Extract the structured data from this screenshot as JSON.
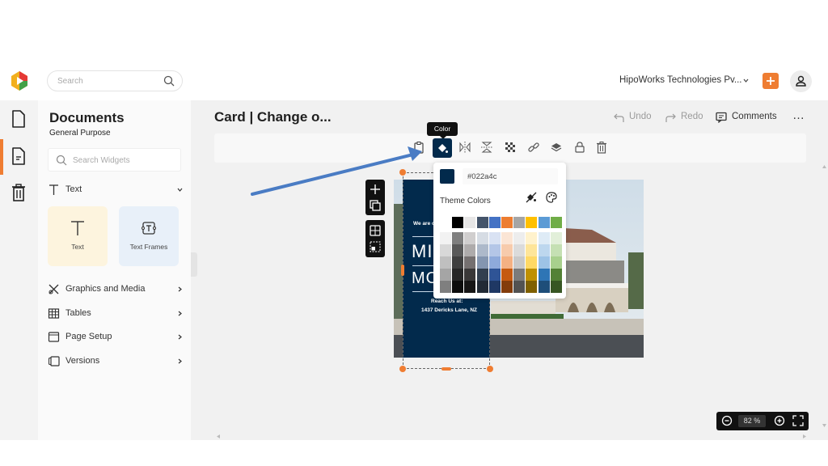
{
  "header": {
    "search_placeholder": "Search",
    "org_name": "HipoWorks Technologies Pv...",
    "add_button": "+",
    "brand_color": "#ef7d32"
  },
  "rail": {
    "items": [
      {
        "icon": "file-icon",
        "active": false
      },
      {
        "icon": "document-icon",
        "active": true
      },
      {
        "icon": "trash-icon",
        "active": false
      }
    ]
  },
  "panel": {
    "title": "Documents",
    "subtitle": "General Purpose",
    "search_placeholder": "Search Widgets",
    "text_section": "Text",
    "tiles": [
      {
        "label": "Text",
        "icon": "text-icon"
      },
      {
        "label": "Text Frames",
        "icon": "text-frame-icon"
      }
    ],
    "sections": [
      {
        "label": "Graphics and Media",
        "icon": "graphics-icon"
      },
      {
        "label": "Tables",
        "icon": "table-icon"
      },
      {
        "label": "Page Setup",
        "icon": "page-setup-icon"
      },
      {
        "label": "Versions",
        "icon": "versions-icon"
      }
    ]
  },
  "document": {
    "title": "Card | Change o...",
    "undo": "Undo",
    "redo": "Redo",
    "comments": "Comments",
    "more": "…"
  },
  "toolbar": {
    "tooltip": "Color",
    "items": [
      "paste-icon",
      "color-fill-icon",
      "flip-horizontal-icon",
      "flip-vertical-icon",
      "transparency-icon",
      "link-icon",
      "layers-icon",
      "lock-icon",
      "delete-icon"
    ]
  },
  "card": {
    "intro": "We are o",
    "line1": "MI",
    "line2": "MO",
    "reach": "Reach Us at:",
    "address": "1437 Dericks Lane, NZ"
  },
  "color_picker": {
    "current_hex": "#022a4c",
    "theme_label": "Theme Colors",
    "base_row": [
      "#ffffff",
      "#000000",
      "#e7e6e6",
      "#44546a",
      "#4472c4",
      "#ed7d31",
      "#a5a5a5",
      "#ffc000",
      "#5b9bd5",
      "#70ad47"
    ],
    "shade_rows": [
      [
        "#f2f2f2",
        "#7f7f7f",
        "#d0cece",
        "#d6dce4",
        "#d9e2f3",
        "#fbe5d5",
        "#ededed",
        "#fff2cc",
        "#deebf6",
        "#e2efd9"
      ],
      [
        "#d8d8d8",
        "#595959",
        "#aeabab",
        "#adb9ca",
        "#b4c6e7",
        "#f7cbac",
        "#dbdbdb",
        "#fee599",
        "#bdd7ee",
        "#c5e0b3"
      ],
      [
        "#bfbfbf",
        "#3f3f3f",
        "#757070",
        "#8496b0",
        "#8eaadb",
        "#f4b183",
        "#c9c9c9",
        "#ffd966",
        "#9dc3e6",
        "#a8d08d"
      ],
      [
        "#a5a5a5",
        "#262626",
        "#3a3838",
        "#323f4f",
        "#2f5496",
        "#c55a11",
        "#7b7b7b",
        "#bf9000",
        "#2e75b5",
        "#538135"
      ],
      [
        "#7f7f7f",
        "#0c0c0c",
        "#171616",
        "#222a35",
        "#1f3864",
        "#833c0b",
        "#525252",
        "#7f6000",
        "#1e4e79",
        "#375623"
      ]
    ]
  },
  "zoom": {
    "value": "82",
    "unit": "%"
  }
}
